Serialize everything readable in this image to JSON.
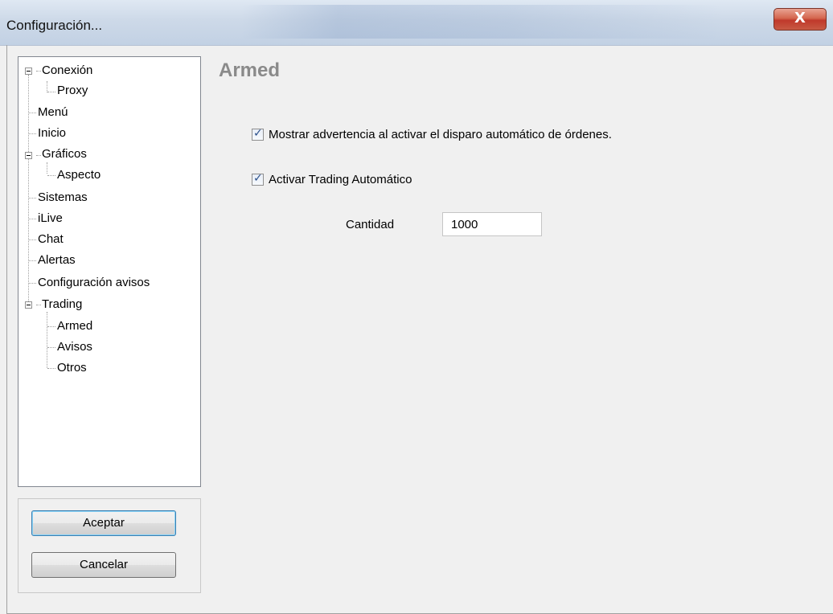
{
  "window": {
    "title": "Configuración...",
    "close_label": "X"
  },
  "tree": {
    "items": [
      {
        "label": "Conexión",
        "expander": "minus-box"
      },
      {
        "label": "Proxy"
      },
      {
        "label": "Menú"
      },
      {
        "label": "Inicio"
      },
      {
        "label": "Gráficos",
        "expander": "minus-box"
      },
      {
        "label": "Aspecto"
      },
      {
        "label": "Sistemas"
      },
      {
        "label": "iLive"
      },
      {
        "label": "Chat"
      },
      {
        "label": "Alertas"
      },
      {
        "label": "Configuración avisos"
      },
      {
        "label": "Trading",
        "expander": "minus-box"
      },
      {
        "label": "Armed",
        "selected": true
      },
      {
        "label": "Avisos"
      },
      {
        "label": "Otros"
      }
    ]
  },
  "buttons": {
    "accept": "Aceptar",
    "cancel": "Cancelar"
  },
  "page": {
    "title": "Armed",
    "options": [
      {
        "label": "Mostrar advertencia al activar el disparo automático de órdenes.",
        "checked": true
      },
      {
        "label": "Activar Trading Automático",
        "checked": true
      }
    ],
    "quantity_label": "Cantidad",
    "quantity_value": "1000"
  },
  "colors": {
    "page_title": "#8a8a8a",
    "close_button": "#c0392b",
    "background": "#f0f0f0"
  }
}
